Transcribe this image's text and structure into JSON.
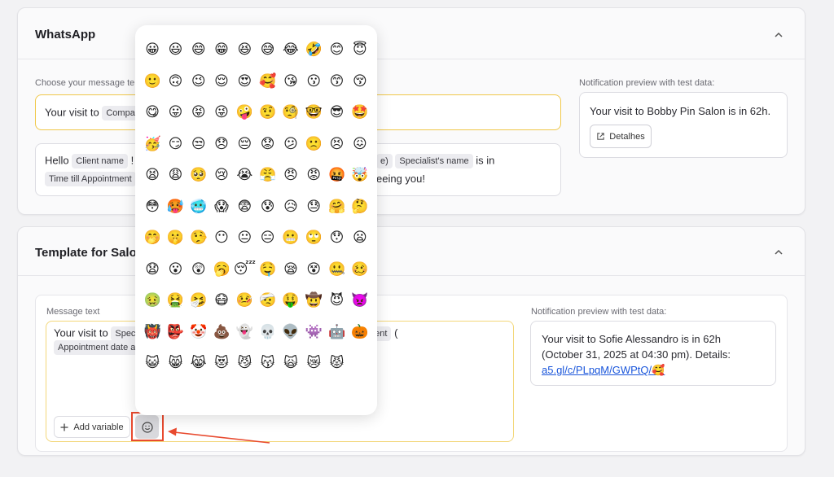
{
  "whatsapp": {
    "title": "WhatsApp",
    "choose_label": "Choose your message te",
    "selected_prefix": "Your visit to",
    "selected_chip": "Compa",
    "alt_line1_prefix": "Hello",
    "alt_chip_client": "Client name",
    "alt_line1_mid": "!",
    "alt_chip_partial": "e)",
    "alt_chip_specialist": "Specialist's name",
    "alt_line1_suffix": "is in",
    "alt_chip_time": "Time till Appointment",
    "alt_line2_suffix": "eeing you!",
    "preview_label": "Notification preview with test data:",
    "preview_text": "Your visit to Bobby Pin Salon is in 62h.",
    "details_button": "Detalhes"
  },
  "salon": {
    "title": "Template for Salon",
    "message_label": "Message text",
    "line1_prefix": "Your visit to",
    "chip_spec": "Spec",
    "chip_ment": "ment",
    "line1_paren": "(",
    "chip_date": "Appointment date an",
    "add_variable": "Add variable",
    "preview_label": "Notification preview with test data:",
    "preview_line1": "Your visit to  Sofie Alessandro is in 62h",
    "preview_line2": "(October 31, 2025 at 04:30 pm). Details:",
    "preview_link": "a5.gl/c/PLpqM/GWPtQ/🥰"
  },
  "emoji_picker": {
    "emojis": [
      "😀",
      "😃",
      "😄",
      "😁",
      "😆",
      "😅",
      "😂",
      "🤣",
      "😊",
      "😇",
      "🙂",
      "🙃",
      "😉",
      "😌",
      "😍",
      "🥰",
      "😘",
      "😗",
      "😙",
      "😚",
      "😋",
      "😛",
      "😝",
      "😜",
      "🤪",
      "🤨",
      "🧐",
      "🤓",
      "😎",
      "🤩",
      "🥳",
      "😏",
      "😒",
      "😞",
      "😔",
      "😟",
      "😕",
      "🙁",
      "😣",
      "😖",
      "😫",
      "😩",
      "🥺",
      "😢",
      "😭",
      "😤",
      "😠",
      "😡",
      "🤬",
      "🤯",
      "😳",
      "🥵",
      "🥶",
      "😱",
      "😨",
      "😰",
      "😥",
      "😓",
      "🤗",
      "🤔",
      "🤭",
      "🤫",
      "🤥",
      "😶",
      "😐",
      "😑",
      "😬",
      "🙄",
      "😯",
      "😦",
      "😧",
      "😮",
      "😲",
      "🥱",
      "😴",
      "🤤",
      "😪",
      "😵",
      "🤐",
      "🥴",
      "🤢",
      "🤮",
      "🤧",
      "😷",
      "🤒",
      "🤕",
      "🤑",
      "🤠",
      "😈",
      "👿",
      "👹",
      "👺",
      "🤡",
      "💩",
      "👻",
      "💀",
      "👽",
      "👾",
      "🤖",
      "🎃",
      "😺",
      "😸",
      "😹",
      "😻",
      "😼",
      "😽",
      "🙀",
      "😿",
      "😾"
    ]
  }
}
